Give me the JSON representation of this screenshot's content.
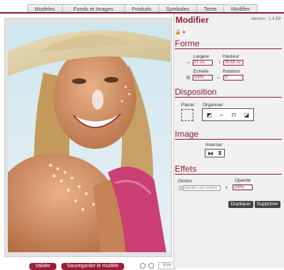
{
  "tabs": [
    "Modèles",
    "Fonds et Images",
    "Produits",
    "Symboles",
    "Texte",
    "Modifier"
  ],
  "colors": {
    "accent": "#8b1c34",
    "panel_bg": "#f0f0f0"
  },
  "panel": {
    "title": "Modifier",
    "version": "version : 1.4.59",
    "lock_icons": "🔒 ●"
  },
  "forme": {
    "title": "Forme",
    "largeur_label": "Largeur",
    "hauteur_label": "Hauteur",
    "largeur_value": "21 cm",
    "hauteur_value": "29.68 cm",
    "echelle_label": "Echelle",
    "rotation_label": "Rotation",
    "echelle_value": "100%",
    "rotation_value": "0°"
  },
  "disposition": {
    "title": "Disposition",
    "placer_label": "Placer",
    "organiser_label": "Organiser"
  },
  "image": {
    "title": "Image",
    "inverser_label": "Inverser"
  },
  "effets": {
    "title": "Effets",
    "ombre_label": "Ombre",
    "ombre_value": "Ajouter une ombre",
    "opacite_label": "Opacité",
    "opacite_value": "100%"
  },
  "actions": {
    "dupliquer": "Dupliquer",
    "supprimer": "Supprimer"
  },
  "bottom": {
    "valider": "Valider",
    "sauvegarder": "Sauvegarder le modèle",
    "zoom_value": "50%"
  }
}
